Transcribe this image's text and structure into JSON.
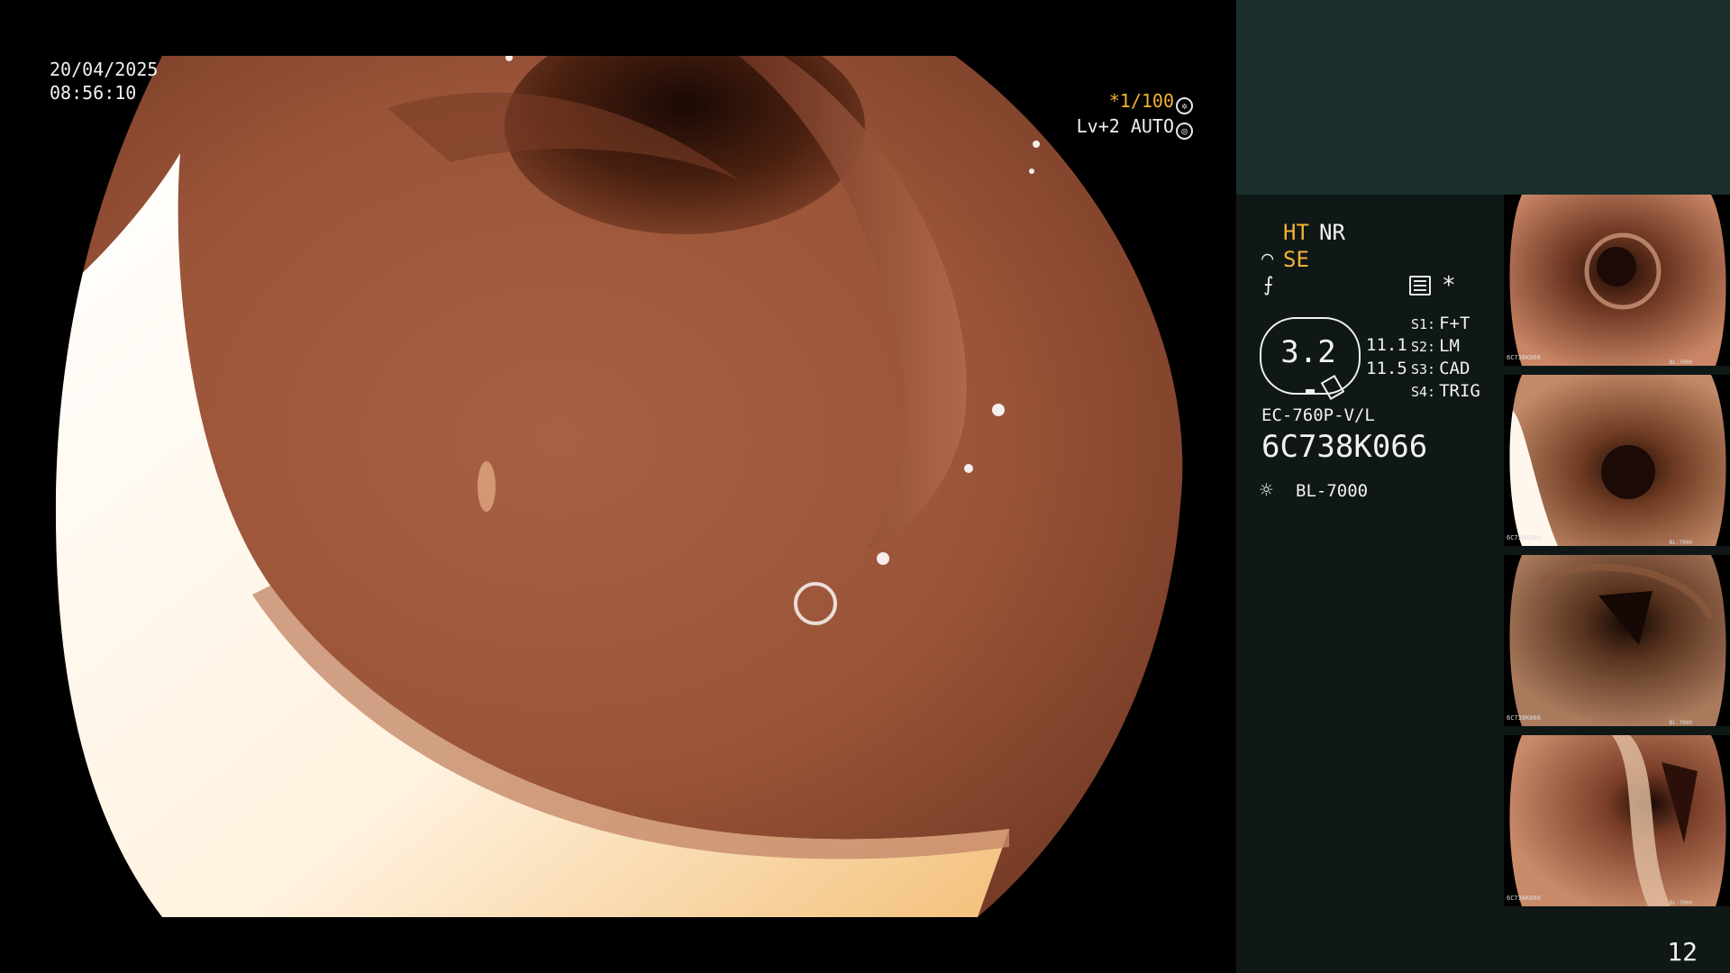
{
  "overlay": {
    "date": "20/04/2025",
    "time": "08:56:10",
    "shutter": "*1/100",
    "level": "Lv+2 AUTO"
  },
  "panel": {
    "ht": "HT",
    "nr": "NR",
    "se": "SE",
    "se_icon": "⌒",
    "nf_icon": "⨍",
    "asterisk": "*",
    "zoom_value": "3.2",
    "value_a": "11.1",
    "value_b": "11.5",
    "scope_buttons": [
      {
        "key": "S1:",
        "label": "F+T"
      },
      {
        "key": "S2:",
        "label": "LM"
      },
      {
        "key": "S3:",
        "label": "CAD"
      },
      {
        "key": "S4:",
        "label": "TRIG"
      }
    ],
    "scope_model": "EC-760P-V/L",
    "scope_serial": "6C738K066",
    "light_icon": "☼",
    "light_source": "BL-7000"
  },
  "thumbnails": [
    {
      "id": "6C738K066",
      "light": "BL-7000"
    },
    {
      "id": "6C738K066",
      "light": "BL-7000"
    },
    {
      "id": "6C738K066",
      "light": "BL-7000"
    },
    {
      "id": "6C738K066",
      "light": "BL-7000"
    }
  ],
  "image_count": "12",
  "colors": {
    "accent_orange": "#f2b135",
    "panel_header": "#1b2f2c",
    "panel_body": "#0f1816"
  }
}
